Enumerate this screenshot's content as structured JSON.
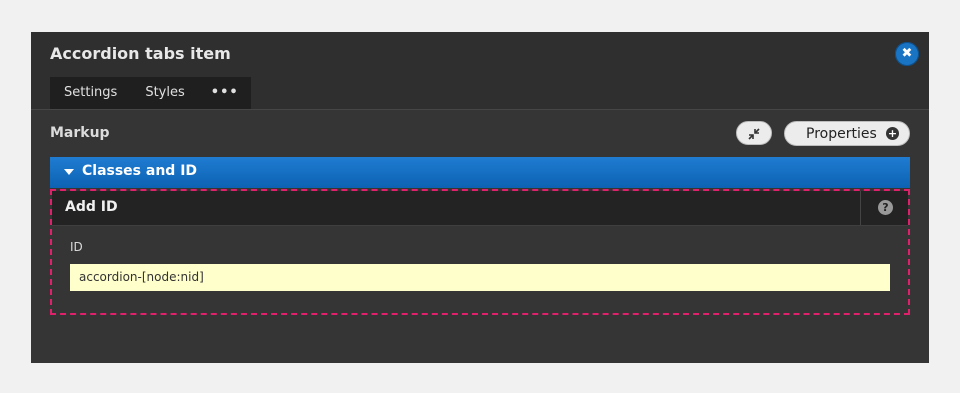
{
  "dialog": {
    "title": "Accordion tabs item",
    "close_icon": "close-icon",
    "tabs": [
      {
        "label": "Settings"
      },
      {
        "label": "Styles"
      },
      {
        "label": "•••"
      }
    ]
  },
  "markup": {
    "label": "Markup",
    "collapse_icon": "compress-arrows-icon",
    "properties_label": "Properties",
    "properties_icon": "plus-circle-icon"
  },
  "section": {
    "label": "Classes and ID",
    "expanded": true
  },
  "panel": {
    "title": "Add ID",
    "help_icon": "question-circle-icon",
    "field_label": "ID",
    "field_value": "accordion-[node:nid]"
  },
  "colors": {
    "accent_blue": "#1a74c4",
    "highlight_dash": "#e0206b",
    "input_bg": "#ffffcc"
  }
}
